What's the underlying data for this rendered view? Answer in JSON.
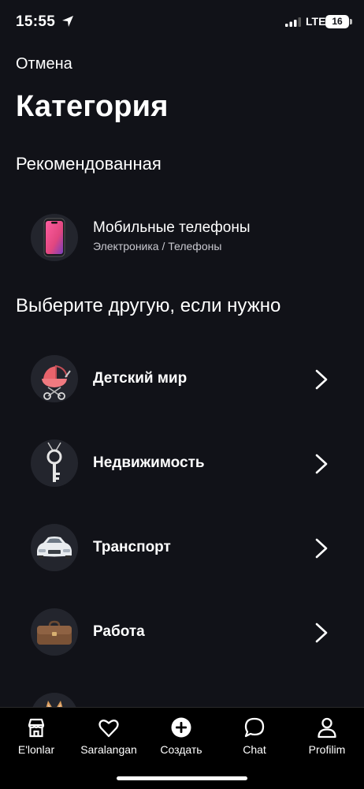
{
  "status_bar": {
    "time": "15:55",
    "network": "LTE",
    "battery": "16"
  },
  "header": {
    "cancel_label": "Отмена",
    "title": "Категория"
  },
  "recommended": {
    "section_title": "Рекомендованная",
    "item": {
      "name": "Мобильные телефоны",
      "path": "Электроника / Телефоны",
      "icon": "smartphone-icon"
    }
  },
  "other": {
    "section_title": "Выберите другую, если нужно",
    "items": [
      {
        "label": "Детский мир",
        "icon": "stroller-icon"
      },
      {
        "label": "Недвижимость",
        "icon": "key-icon"
      },
      {
        "label": "Транспорт",
        "icon": "car-icon"
      },
      {
        "label": "Работа",
        "icon": "briefcase-icon"
      },
      {
        "label": "",
        "icon": "cat-icon"
      }
    ]
  },
  "tabbar": {
    "items": [
      {
        "label": "E'lonlar",
        "icon": "shop-icon"
      },
      {
        "label": "Saralangan",
        "icon": "heart-icon"
      },
      {
        "label": "Создать",
        "icon": "plus-circle-icon"
      },
      {
        "label": "Chat",
        "icon": "chat-bubble-icon"
      },
      {
        "label": "Profilim",
        "icon": "user-icon"
      }
    ]
  },
  "colors": {
    "background": "#111218",
    "text": "#ffffff",
    "thumb_bg": "#23252d",
    "tabbar_bg": "#000000"
  }
}
